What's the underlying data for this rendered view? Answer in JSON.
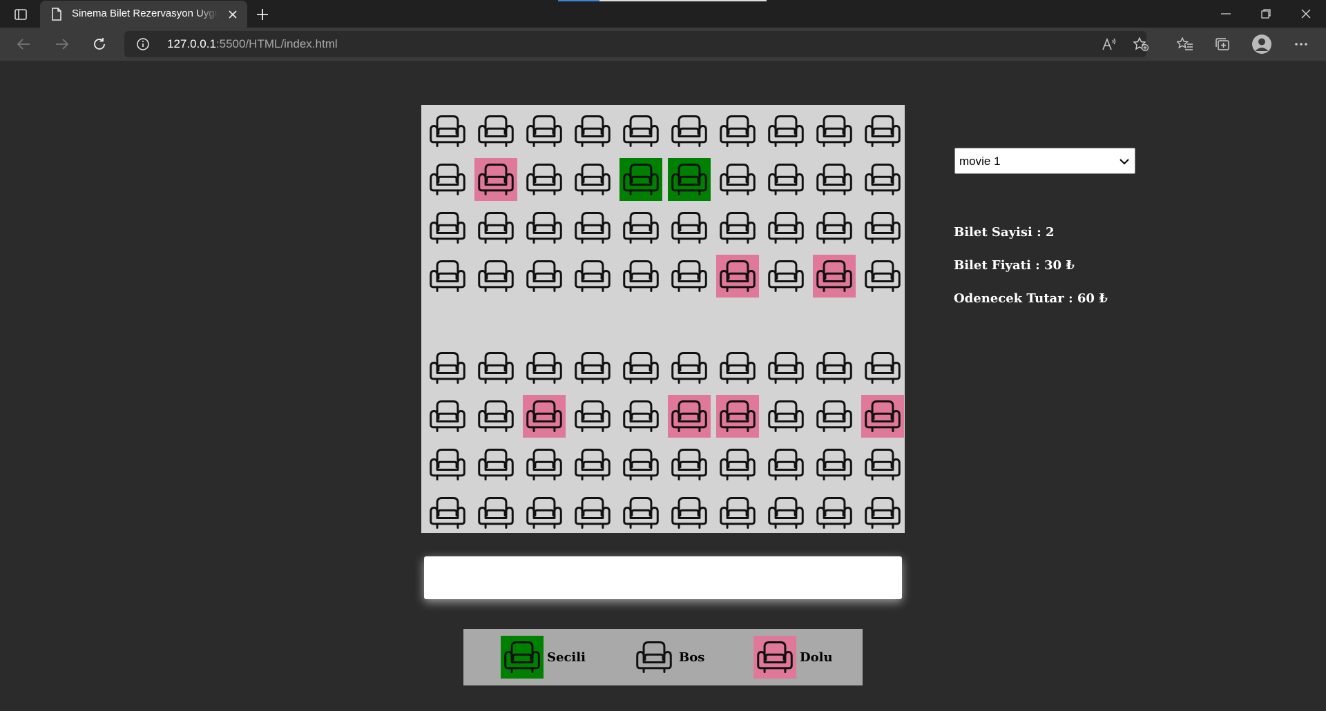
{
  "browser": {
    "tab_title": "Sinema Bilet Rezervasyon Uygulaması",
    "url_host": "127.0.0.1",
    "url_path": ":5500/HTML/index.html"
  },
  "movie_select": {
    "selected": "movie 1"
  },
  "info": {
    "ticket_count": "Bilet Sayisi : 2",
    "ticket_price": "Bilet Fiyati : 30 ₺",
    "total": "Odenecek Tutar : 60 ₺"
  },
  "seats": {
    "rows": [
      [
        "empty",
        "empty",
        "empty",
        "empty",
        "empty",
        "empty",
        "empty",
        "empty",
        "empty",
        "empty"
      ],
      [
        "empty",
        "occupied",
        "empty",
        "empty",
        "selected",
        "selected",
        "empty",
        "empty",
        "empty",
        "empty"
      ],
      [
        "empty",
        "empty",
        "empty",
        "empty",
        "empty",
        "empty",
        "empty",
        "empty",
        "empty",
        "empty"
      ],
      [
        "empty",
        "empty",
        "empty",
        "empty",
        "empty",
        "empty",
        "occupied",
        "empty",
        "occupied",
        "empty"
      ],
      [
        "empty",
        "empty",
        "empty",
        "empty",
        "empty",
        "empty",
        "empty",
        "empty",
        "empty",
        "empty"
      ],
      [
        "empty",
        "empty",
        "occupied",
        "empty",
        "empty",
        "occupied",
        "occupied",
        "empty",
        "empty",
        "occupied"
      ],
      [
        "empty",
        "empty",
        "empty",
        "empty",
        "empty",
        "empty",
        "empty",
        "empty",
        "empty",
        "empty"
      ],
      [
        "empty",
        "empty",
        "empty",
        "empty",
        "empty",
        "empty",
        "empty",
        "empty",
        "empty",
        "empty"
      ]
    ]
  },
  "legend": {
    "selected_label": "Secili",
    "empty_label": "Bos",
    "occupied_label": "Dolu"
  },
  "colors": {
    "selected": "#008000",
    "occupied": "#e0789a",
    "seat_area": "#d3d3d3",
    "legend_bg": "#a9a9a9"
  }
}
